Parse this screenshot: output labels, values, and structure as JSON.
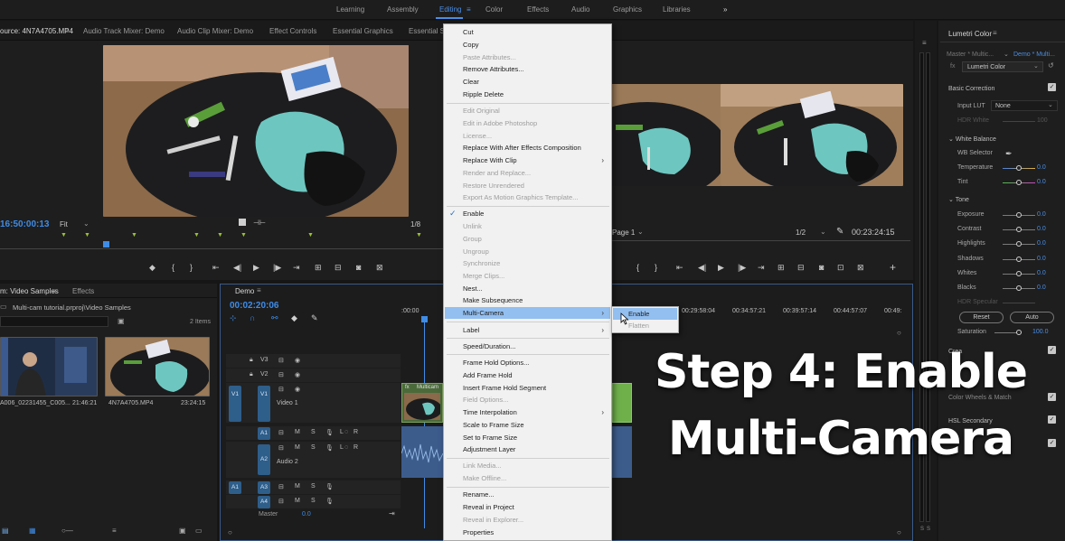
{
  "workspaces": [
    "Learning",
    "Assembly",
    "Editing",
    "Color",
    "Effects",
    "Audio",
    "Graphics",
    "Libraries"
  ],
  "workspace_more": "»",
  "source_tabs": [
    "ource: 4N7A4705.MP4",
    "Audio Track Mixer: Demo",
    "Audio Clip Mixer: Demo",
    "Effect Controls",
    "Essential Graphics",
    "Essential So"
  ],
  "source_monitor": {
    "timecode": "16:50:00:13",
    "zoom": "Fit",
    "resolution": "1/8"
  },
  "program_monitor": {
    "page": "Page 1",
    "resolution": "1/2",
    "timecode": "00:23:24:15"
  },
  "project": {
    "tabs": [
      "m: Video Samples",
      "Effects"
    ],
    "path": "Multi-cam tutorial.prproj\\Video Samples",
    "item_count": "2 Items",
    "clips": [
      {
        "name": "A006_02231455_C005...",
        "duration": "21:46:21"
      },
      {
        "name": "4N7A4705.MP4",
        "duration": "23:24:15"
      }
    ]
  },
  "timeline": {
    "sequence": "Demo",
    "timecode": "00:02:20:06",
    "ruler": [
      ":00:00",
      "00:29:58:04",
      "00:34:57:21",
      "00:39:57:14",
      "00:44:57:07",
      "00:49:"
    ],
    "clip_label": "Multicam",
    "tracks": [
      {
        "src": "",
        "id": "V3",
        "name": ""
      },
      {
        "src": "",
        "id": "V2",
        "name": ""
      },
      {
        "src": "V1",
        "id": "V1",
        "name": "Video 1"
      },
      {
        "src": "",
        "id": "A1",
        "name": ""
      },
      {
        "src": "",
        "id": "A2",
        "name": "Audio 2"
      },
      {
        "src": "A1",
        "id": "A3",
        "name": ""
      },
      {
        "src": "A1",
        "id": "A4",
        "name": ""
      }
    ],
    "track_toggles": {
      "mute": "M",
      "solo": "S",
      "left": "L",
      "right": "R"
    },
    "master_label": "Master",
    "master_value": "0.0"
  },
  "context_menu": {
    "items": [
      {
        "label": "Cut",
        "disabled": false
      },
      {
        "label": "Copy",
        "disabled": false
      },
      {
        "label": "Paste Attributes...",
        "disabled": true
      },
      {
        "label": "Remove Attributes...",
        "disabled": false
      },
      {
        "label": "Clear",
        "disabled": false
      },
      {
        "label": "Ripple Delete",
        "disabled": false
      },
      {
        "label": "Edit Original",
        "disabled": true
      },
      {
        "label": "Edit in Adobe Photoshop",
        "disabled": true
      },
      {
        "label": "License...",
        "disabled": true
      },
      {
        "label": "Replace With After Effects Composition",
        "disabled": false
      },
      {
        "label": "Replace With Clip",
        "disabled": false
      },
      {
        "label": "Render and Replace...",
        "disabled": true
      },
      {
        "label": "Restore Unrendered",
        "disabled": true
      },
      {
        "label": "Export As Motion Graphics Template...",
        "disabled": true
      },
      {
        "label": "Enable",
        "disabled": false
      },
      {
        "label": "Unlink",
        "disabled": true
      },
      {
        "label": "Group",
        "disabled": true
      },
      {
        "label": "Ungroup",
        "disabled": true
      },
      {
        "label": "Synchronize",
        "disabled": true
      },
      {
        "label": "Merge Clips...",
        "disabled": true
      },
      {
        "label": "Nest...",
        "disabled": false
      },
      {
        "label": "Make Subsequence",
        "disabled": false
      },
      {
        "label": "Multi-Camera",
        "disabled": false
      },
      {
        "label": "Label",
        "disabled": false
      },
      {
        "label": "Speed/Duration...",
        "disabled": false
      },
      {
        "label": "Frame Hold Options...",
        "disabled": false
      },
      {
        "label": "Add Frame Hold",
        "disabled": false
      },
      {
        "label": "Insert Frame Hold Segment",
        "disabled": false
      },
      {
        "label": "Field Options...",
        "disabled": true
      },
      {
        "label": "Time Interpolation",
        "disabled": false
      },
      {
        "label": "Scale to Frame Size",
        "disabled": false
      },
      {
        "label": "Set to Frame Size",
        "disabled": false
      },
      {
        "label": "Adjustment Layer",
        "disabled": false
      },
      {
        "label": "Link Media...",
        "disabled": true
      },
      {
        "label": "Make Offline...",
        "disabled": true
      },
      {
        "label": "Rename...",
        "disabled": false
      },
      {
        "label": "Reveal in Project",
        "disabled": false
      },
      {
        "label": "Reveal in Explorer...",
        "disabled": true
      },
      {
        "label": "Properties",
        "disabled": false
      }
    ],
    "checked_item": "Enable",
    "highlighted_item": "Multi-Camera",
    "submenu_arrow": "›"
  },
  "multicam_submenu": [
    {
      "label": "Enable",
      "disabled": false
    },
    {
      "label": "Flatten",
      "disabled": true
    }
  ],
  "lumetri": {
    "title": "Lumetri Color",
    "master": "Master * Multic...",
    "sequence": "Demo * Multi...",
    "effect": "Lumetri Color",
    "basic_correction": "Basic Correction",
    "input_lut_label": "Input LUT",
    "input_lut": "None",
    "hdr_white_label": "HDR White",
    "hdr_white": "100",
    "white_balance": "White Balance",
    "wb_selector": "WB Selector",
    "rows": [
      {
        "label": "Temperature",
        "value": "0.0"
      },
      {
        "label": "Tint",
        "value": "0.0"
      },
      {
        "label": "Exposure",
        "value": "0.0"
      },
      {
        "label": "Contrast",
        "value": "0.0"
      },
      {
        "label": "Highlights",
        "value": "0.0"
      },
      {
        "label": "Shadows",
        "value": "0.0"
      },
      {
        "label": "Whites",
        "value": "0.0"
      },
      {
        "label": "Blacks",
        "value": "0.0"
      }
    ],
    "tone": "Tone",
    "hdr_specular": "HDR Specular",
    "reset": "Reset",
    "auto": "Auto",
    "saturation_label": "Saturation",
    "saturation": "100.0",
    "creative": "Crea",
    "color_wheels": "Color Wheels & Match",
    "hsl_secondary": "HSL Secondary"
  },
  "overlay": {
    "line1": "Step 4: Enable",
    "line2": "Multi-Camera"
  },
  "audio_meter": {
    "labels": [
      "S",
      "S"
    ]
  },
  "colors": {
    "accent": "#4a8ee6",
    "menu_highlight": "#93bff0",
    "track_target": "#2e5e8a",
    "clip_green": "#6fb04b"
  }
}
